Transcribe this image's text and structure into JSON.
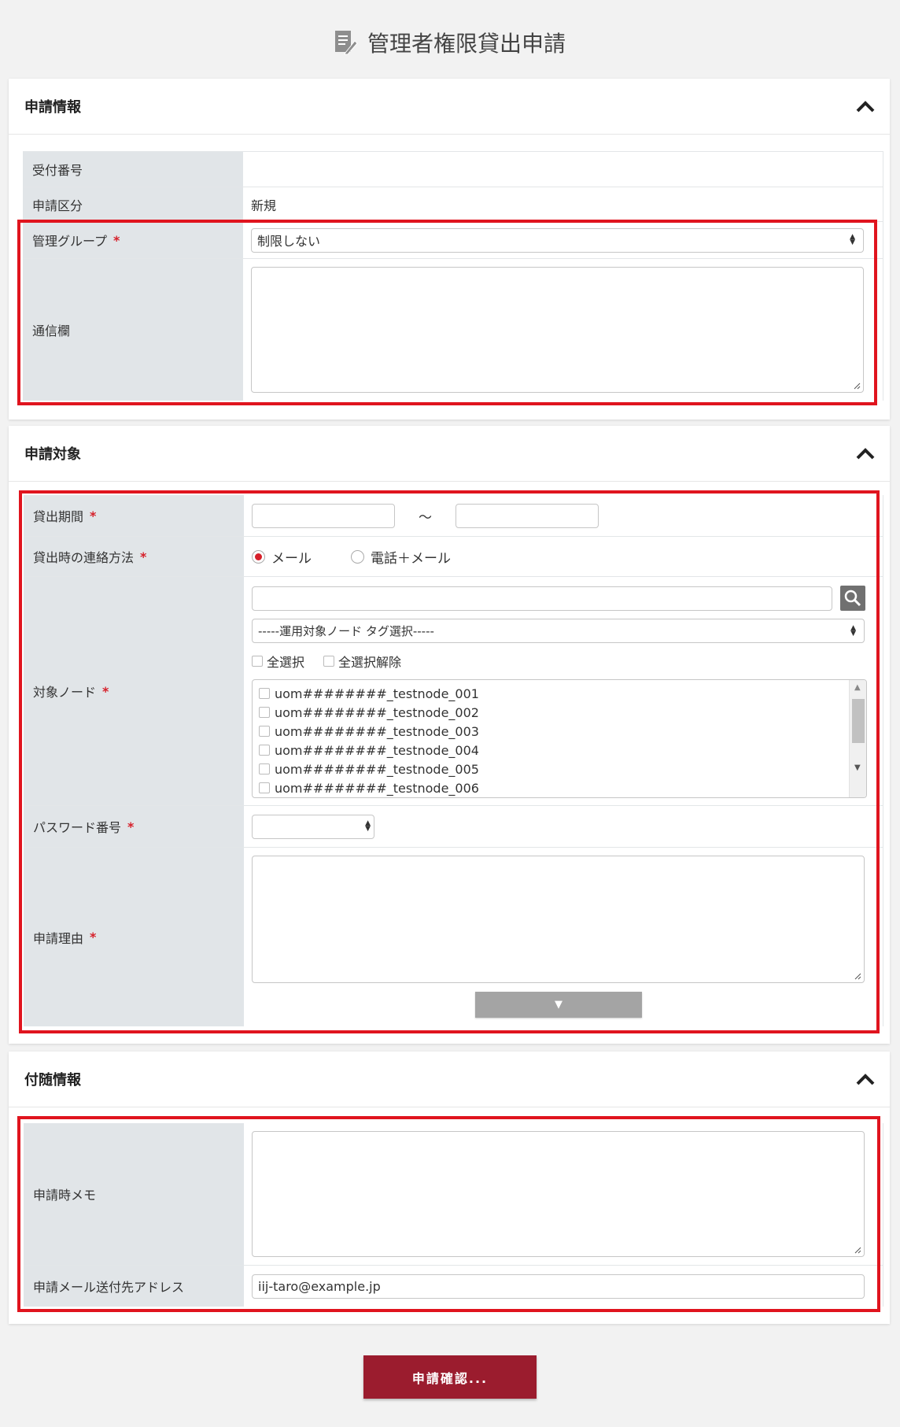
{
  "page": {
    "title": "管理者権限貸出申請"
  },
  "sections": {
    "app_info": {
      "title": "申請情報",
      "fields": {
        "reception_no": {
          "label": "受付番号",
          "value": ""
        },
        "app_type": {
          "label": "申請区分",
          "value": "新規"
        },
        "admin_group": {
          "label": "管理グループ",
          "required": "*",
          "selected": "制限しない"
        },
        "comm": {
          "label": "通信欄",
          "value": ""
        }
      }
    },
    "target": {
      "title": "申請対象",
      "fields": {
        "period": {
          "label": "貸出期間",
          "required": "*",
          "from": "",
          "separator": "～",
          "to": ""
        },
        "contact": {
          "label": "貸出時の連絡方法",
          "required": "*",
          "options": [
            "メール",
            "電話＋メール"
          ],
          "selected": "メール"
        },
        "nodes": {
          "label": "対象ノード",
          "required": "*",
          "search_value": "",
          "tag_select": "-----運用対象ノード タグ選択-----",
          "select_all": "全選択",
          "deselect_all": "全選択解除",
          "items": [
            "uom########_testnode_001",
            "uom########_testnode_002",
            "uom########_testnode_003",
            "uom########_testnode_004",
            "uom########_testnode_005",
            "uom########_testnode_006"
          ]
        },
        "password_no": {
          "label": "パスワード番号",
          "required": "*",
          "selected": ""
        },
        "reason": {
          "label": "申請理由",
          "required": "*",
          "value": ""
        }
      }
    },
    "extra": {
      "title": "付随情報",
      "fields": {
        "memo": {
          "label": "申請時メモ",
          "value": ""
        },
        "mail_to": {
          "label": "申請メール送付先アドレス",
          "value": "iij-taro@example.jp"
        }
      }
    }
  },
  "submit_label": "申請確認...",
  "colors": {
    "accent": "#9b1c2e",
    "required": "#d6202a",
    "highlight": "#e0141e",
    "label_bg": "#e1e5e8"
  }
}
